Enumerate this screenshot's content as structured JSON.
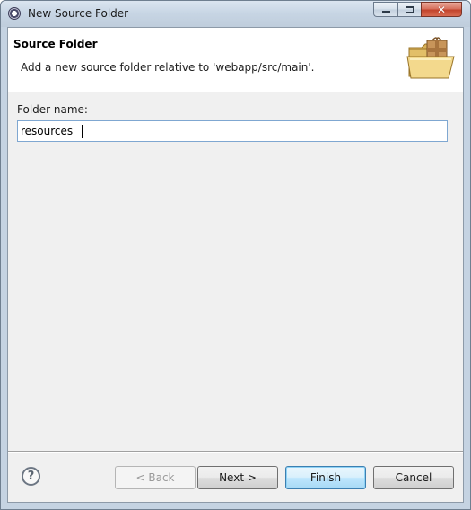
{
  "window": {
    "title": "New Source Folder",
    "caption_buttons": {
      "close_symbol": "✕"
    }
  },
  "banner": {
    "title": "Source Folder",
    "description": "Add a new source folder relative to 'webapp/src/main'.",
    "image_icon": "folder-with-package-icon"
  },
  "form": {
    "folder_name_label": "Folder name:",
    "folder_name_value": "resources"
  },
  "buttons": {
    "help": "?",
    "back": "< Back",
    "next": "Next >",
    "finish": "Finish",
    "cancel": "Cancel"
  },
  "colors": {
    "accent_border": "#3c7fb1",
    "input_border": "#7fa7d1",
    "close_button": "#c2442c"
  }
}
